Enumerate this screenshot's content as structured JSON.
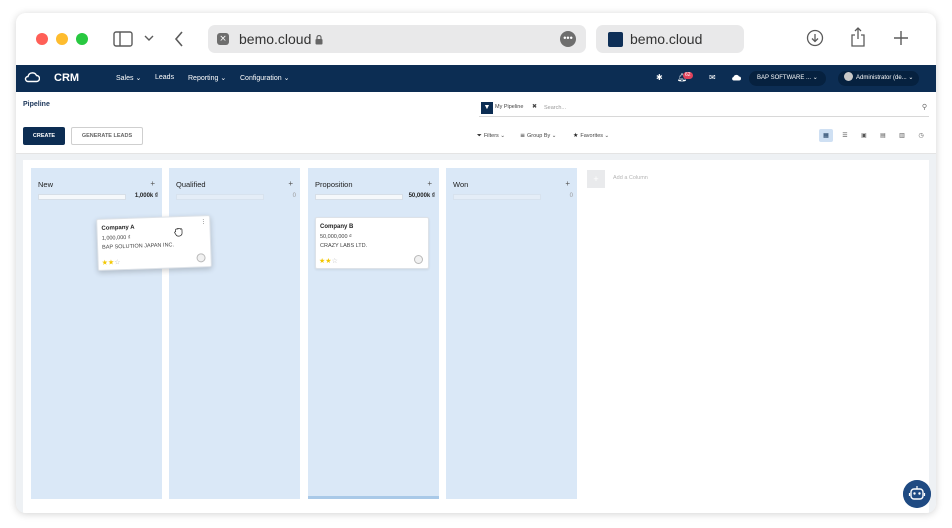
{
  "browser": {
    "url": "bemo.cloud",
    "tab_title": "bemo.cloud"
  },
  "appnav": {
    "brand": "CRM",
    "menu": [
      {
        "label": "Sales",
        "caret": true
      },
      {
        "label": "Leads",
        "caret": false
      },
      {
        "label": "Reporting",
        "caret": true
      },
      {
        "label": "Configuration",
        "caret": true
      }
    ],
    "notification_count": "62",
    "company": "BAP SOFTWARE ...",
    "user": "Administrator (de..."
  },
  "control": {
    "breadcrumb": "Pipeline",
    "create_label": "CREATE",
    "generate_label": "GENERATE LEADS",
    "search_facet": "My Pipeline",
    "search_placeholder": "Search...",
    "filters_label": "Filters",
    "groupby_label": "Group By",
    "favorites_label": "Favorites"
  },
  "kanban": {
    "add_column_label": "Add a Column",
    "columns": [
      {
        "title": "New",
        "sum": "1,000k ₫",
        "fill": 1.0
      },
      {
        "title": "Qualified",
        "sum": "0",
        "fill": 0
      },
      {
        "title": "Proposition",
        "sum": "50,000k ₫",
        "fill": 1.0
      },
      {
        "title": "Won",
        "sum": "0",
        "fill": 0
      }
    ],
    "cards": [
      {
        "title": "Company A",
        "amount": "1,000,000 ₫",
        "partner": "BAP SOLUTION JAPAN INC.",
        "stars": 2,
        "max_stars": 3
      },
      {
        "title": "Company B",
        "amount": "50,000,000 ₫",
        "partner": "CRAZY LABS LTD.",
        "stars": 2,
        "max_stars": 3
      }
    ]
  }
}
